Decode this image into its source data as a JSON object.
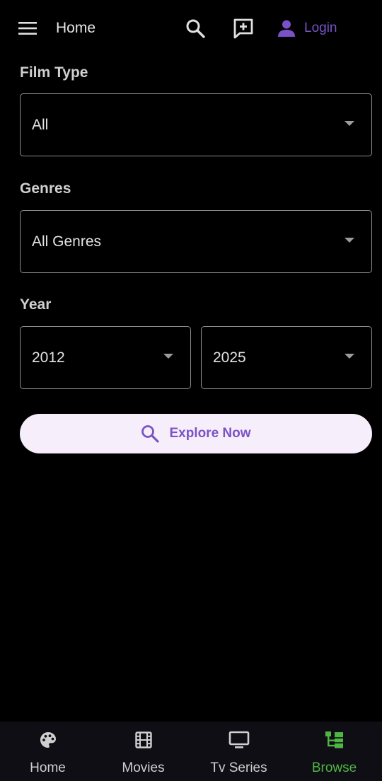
{
  "appbar": {
    "menu_icon": "menu-icon",
    "title": "Home",
    "search_icon": "search-icon",
    "request_icon": "add-comment-icon",
    "login_icon": "person-icon",
    "login_label": "Login",
    "accent_color": "#7a52c7"
  },
  "filters": {
    "film_type": {
      "label": "Film Type",
      "value": "All"
    },
    "genres": {
      "label": "Genres",
      "value": "All Genres"
    },
    "year": {
      "label": "Year",
      "from": "2012",
      "to": "2025"
    }
  },
  "explore": {
    "icon": "search-icon",
    "label": "Explore Now",
    "background": "#f6effb",
    "color": "#7c52c6"
  },
  "bottom_nav": {
    "active_color": "#4fb543",
    "items": [
      {
        "icon": "palette-icon",
        "label": "Home"
      },
      {
        "icon": "film-icon",
        "label": "Movies"
      },
      {
        "icon": "tv-icon",
        "label": "Tv Series"
      },
      {
        "icon": "browse-icon",
        "label": "Browse",
        "active": true
      }
    ]
  }
}
